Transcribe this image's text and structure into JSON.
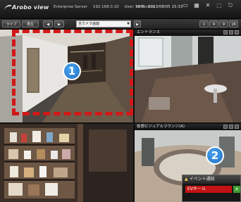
{
  "app": {
    "logo_text": "Arobo view",
    "product": "Enterprise Server",
    "server": "192.168.0.10",
    "user": "User: ab-techno",
    "time_label": "TIME",
    "time_value": "2013/08/05 15:33"
  },
  "top_icons": [
    {
      "icon": "display-icon"
    },
    {
      "icon": "layout-icon"
    },
    {
      "icon": "tools-icon"
    },
    {
      "icon": "lock-icon"
    },
    {
      "icon": "exit-icon"
    }
  ],
  "toolbar": {
    "live_button": "ライブ",
    "play_button": "再生",
    "nav_back": "◀",
    "nav_forward": "▶",
    "group_select": "全カメラ画面",
    "right_buttons": [
      "1",
      "4",
      "9",
      "16"
    ]
  },
  "cameras": [
    {
      "title": "",
      "marker": "1"
    },
    {
      "title": "エントランス"
    },
    {
      "title": ""
    },
    {
      "title": "仮想ビジュアルラウンジ(A)",
      "marker": "2"
    }
  ],
  "event_popup": {
    "title": "イベント通知",
    "event_name": "EVホール",
    "ok_symbol": "✕"
  },
  "colors": {
    "highlight_dash": "#d11818",
    "marker_blue": "#2a86d9",
    "event_red": "#c21212",
    "event_ok_green": "#3c9a2e"
  }
}
